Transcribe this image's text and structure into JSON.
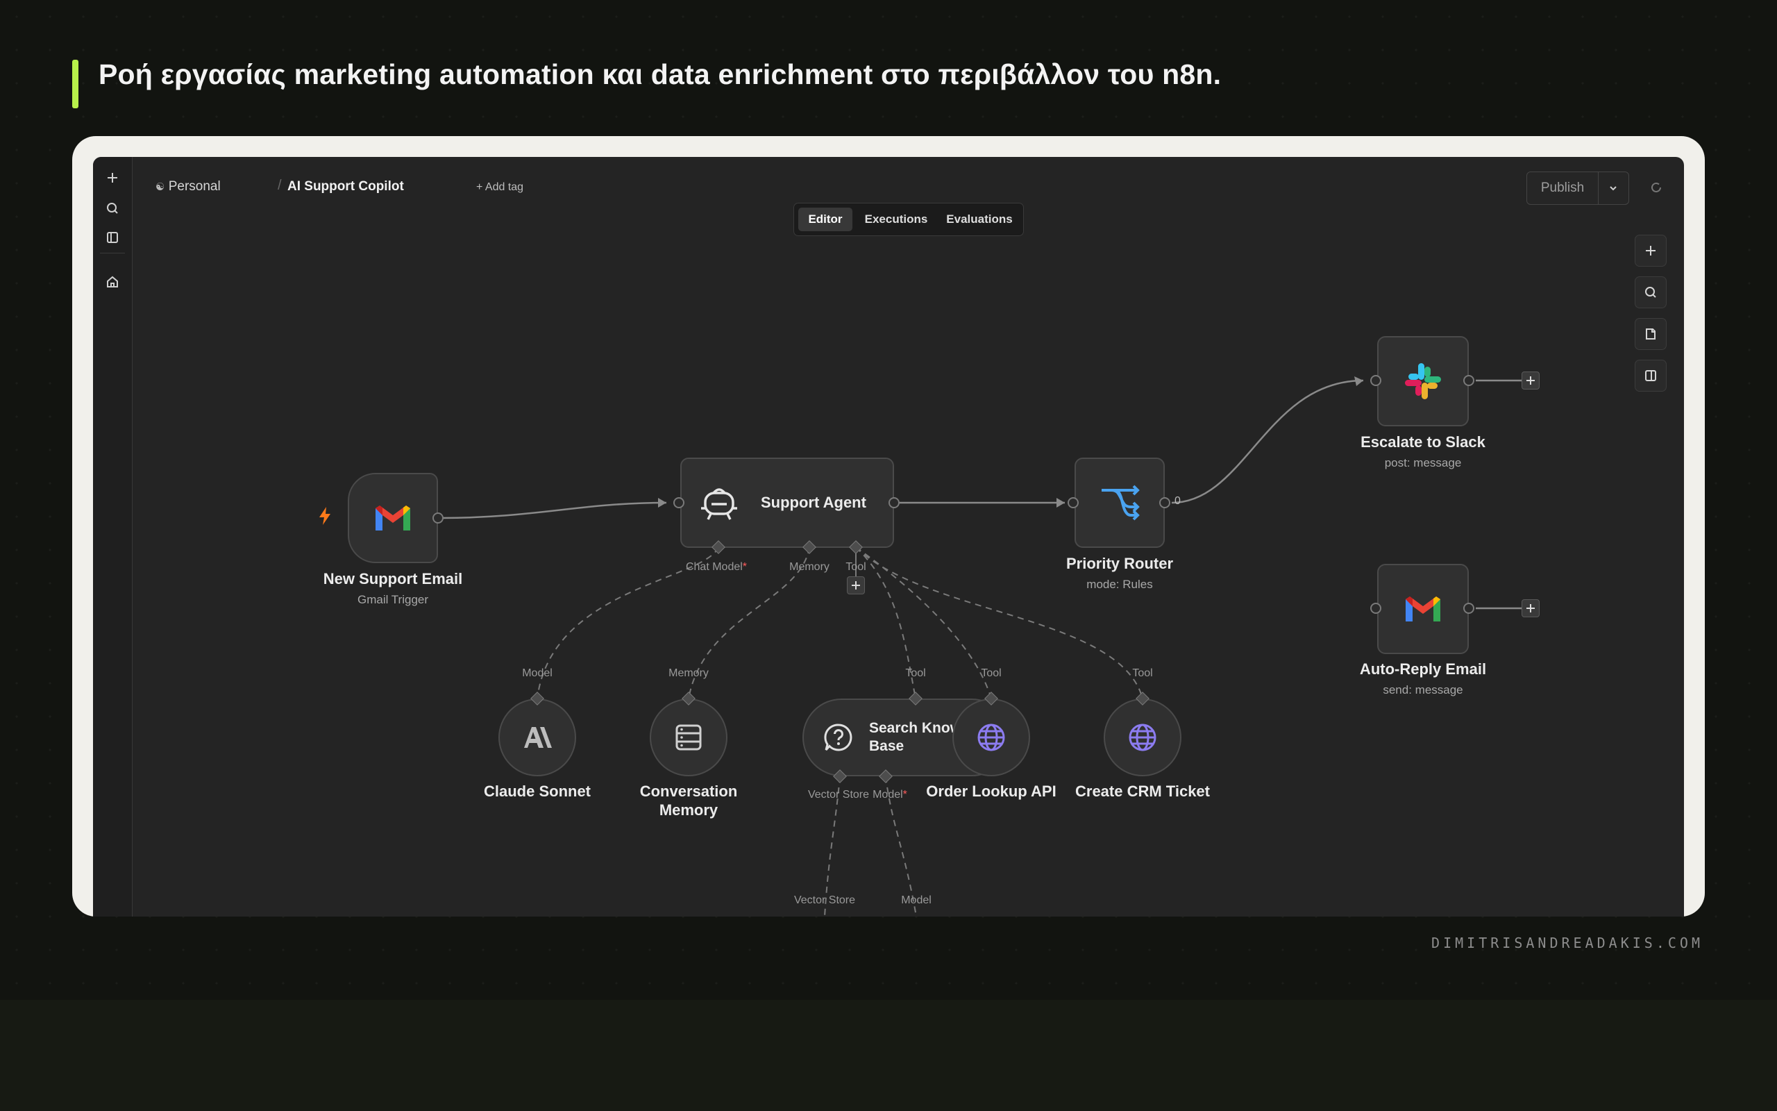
{
  "headline": "Ροή εργασίας marketing automation και data enrichment στο περιβάλλον του n8n.",
  "footer": "DIMITRISANDREADAKIS.COM",
  "header": {
    "project": "Personal",
    "workflow_name": "AI Support Copilot",
    "add_tag": "+ Add tag",
    "publish_label": "Publish"
  },
  "tabs": [
    {
      "label": "Editor",
      "active": true
    },
    {
      "label": "Executions",
      "active": false
    },
    {
      "label": "Evaluations",
      "active": false
    }
  ],
  "nodes": {
    "trigger": {
      "title": "New Support Email",
      "subtitle": "Gmail Trigger",
      "icon": "gmail-icon"
    },
    "agent": {
      "title": "Support Agent",
      "icon": "robot-icon",
      "ports": {
        "chat_model": "Chat Model",
        "memory": "Memory",
        "tool": "Tool"
      }
    },
    "router": {
      "title": "Priority Router",
      "subtitle": "mode: Rules",
      "icon": "router-icon",
      "output_label": "0"
    },
    "slack": {
      "title": "Escalate to Slack",
      "subtitle": "post: message",
      "icon": "slack-icon"
    },
    "reply": {
      "title": "Auto-Reply Email",
      "subtitle": "send: message",
      "icon": "gmail-icon"
    },
    "claude": {
      "title": "Claude Sonnet",
      "port": "Model",
      "icon": "anthropic-icon"
    },
    "memory": {
      "title_line1": "Conversation",
      "title_line2": "Memory",
      "port": "Memory",
      "icon": "database-icon"
    },
    "kb": {
      "title_line1": "Search Knowledge",
      "title_line2": "Base",
      "port": "Tool",
      "port_vector": "Vector Store",
      "port_model": "Model",
      "icon": "question-icon"
    },
    "order": {
      "title": "Order Lookup API",
      "port": "Tool",
      "icon": "globe-icon"
    },
    "crm": {
      "title": "Create CRM Ticket",
      "port": "Tool",
      "icon": "globe-icon"
    },
    "below": {
      "vector_store": "Vector Store",
      "model": "Model"
    }
  },
  "colors": {
    "accent": "#b7f04a",
    "canvas": "#242424",
    "globe": "#8c7cf0",
    "router": "#4aa3f0",
    "trigger_bolt": "#ff7a1a"
  }
}
